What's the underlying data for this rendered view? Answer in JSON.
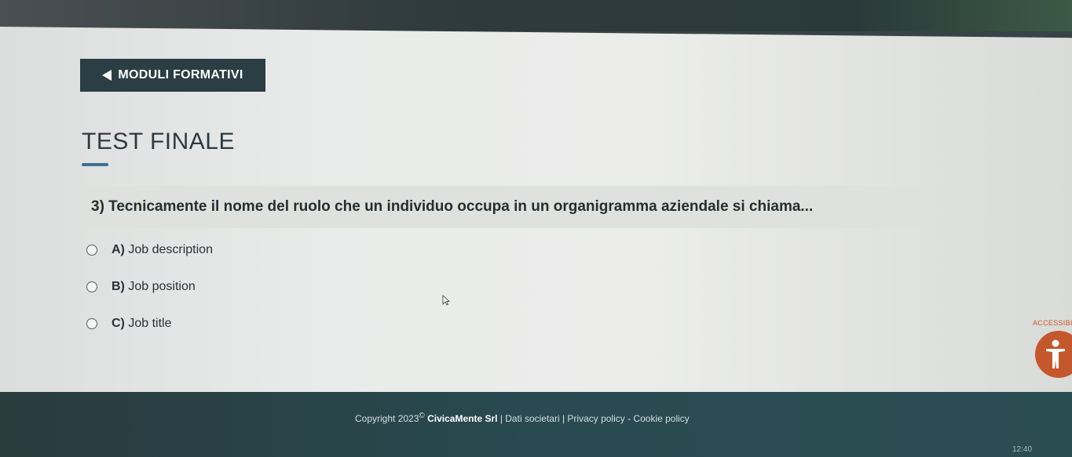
{
  "nav": {
    "back_label": "MODULI FORMATIVI"
  },
  "page": {
    "title": "TEST FINALE"
  },
  "question": {
    "text": "3) Tecnicamente il nome del ruolo che un individuo occupa in un organigramma aziendale si chiama...",
    "options": [
      {
        "letter": "A)",
        "label": "Job description"
      },
      {
        "letter": "B)",
        "label": "Job position"
      },
      {
        "letter": "C)",
        "label": "Job title"
      }
    ]
  },
  "accessibility": {
    "label": "ACCESSIBIL",
    "icon": "accessibility-person-icon"
  },
  "footer": {
    "copyright_prefix": "Copyright 2023",
    "copyright_symbol": "©",
    "company": "CivicaMente Srl",
    "links": " | Dati societari | Privacy policy - Cookie policy"
  },
  "taskbar": {
    "time": "12:40"
  },
  "colors": {
    "nav_button_bg": "#2a3e44",
    "accent_underline": "#3f6f8f",
    "accessibility_orange": "#c4582c",
    "footer_bg": "#284a50"
  }
}
